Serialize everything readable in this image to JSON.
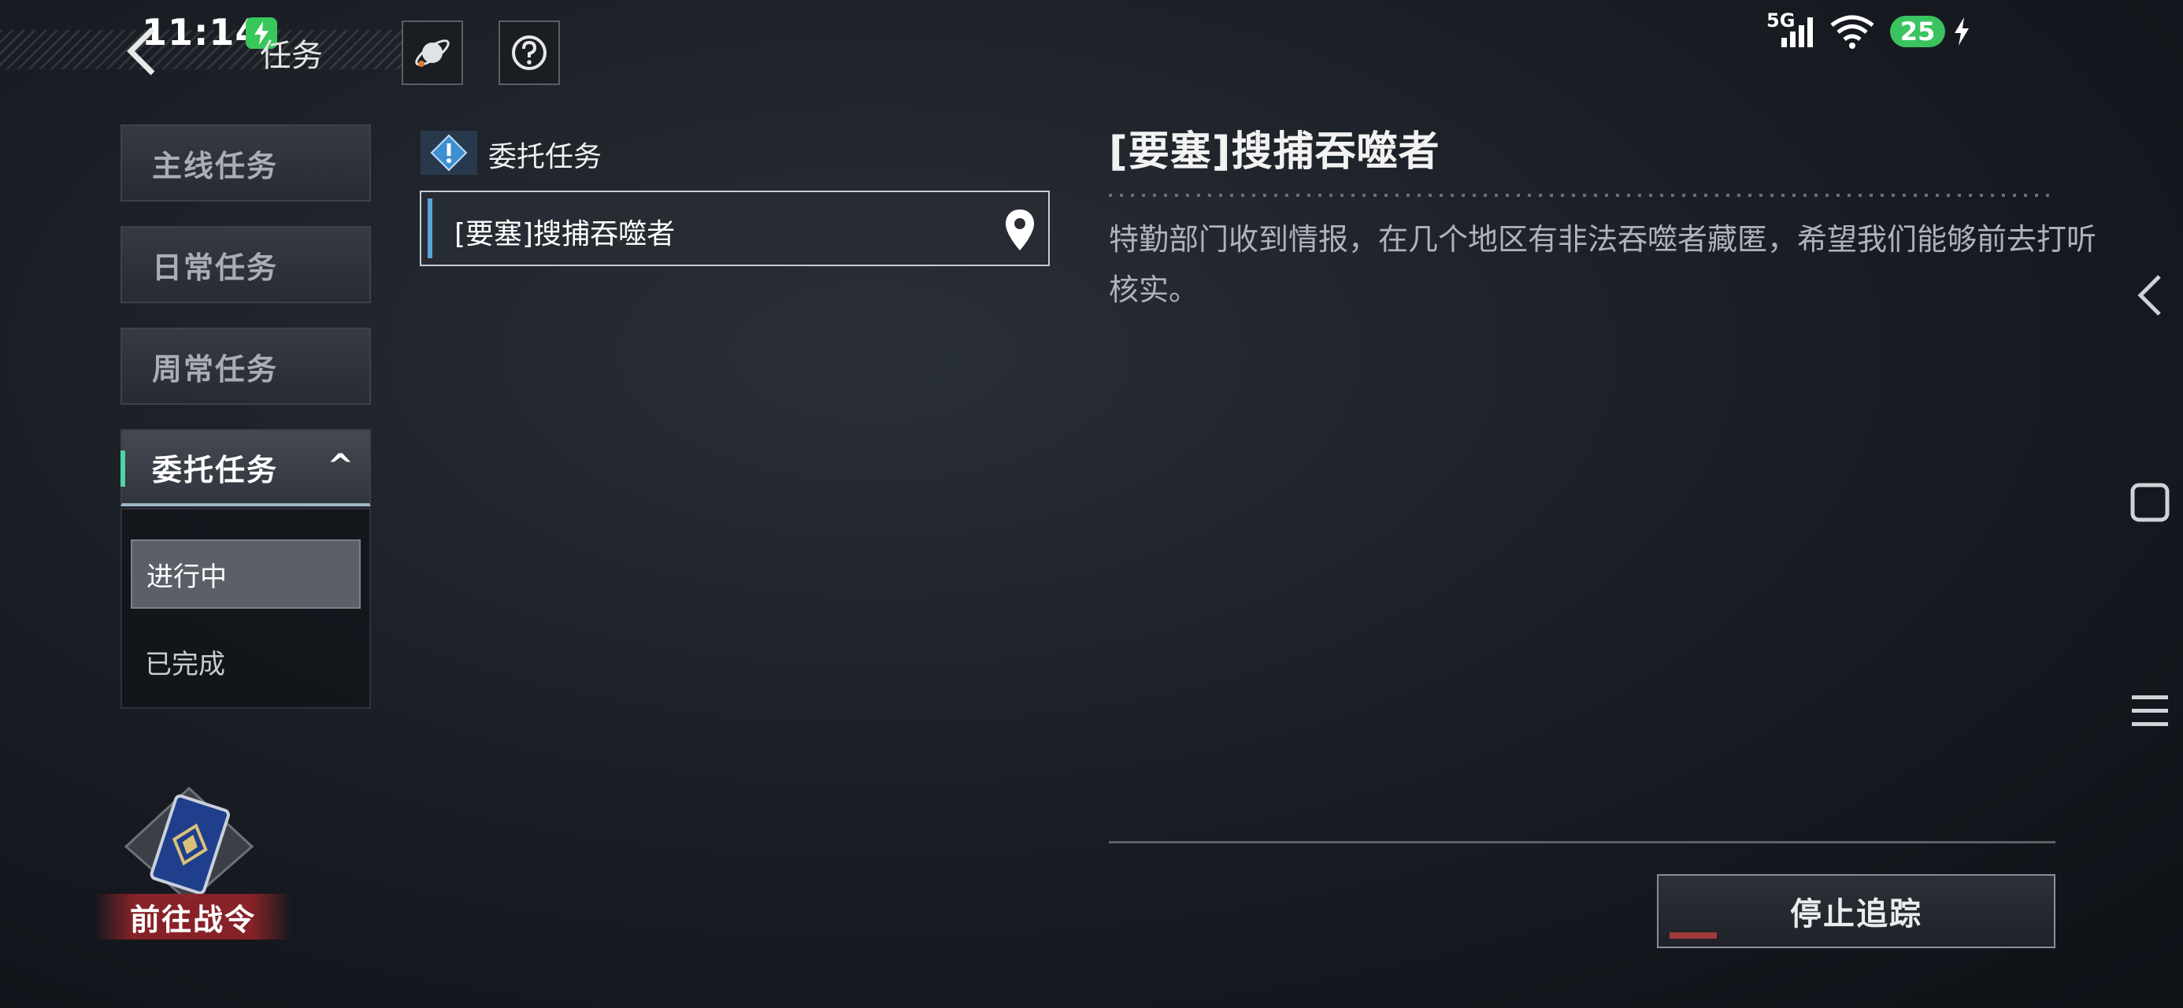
{
  "status_bar": {
    "time": "11:14",
    "network": "5G",
    "battery": "25"
  },
  "header": {
    "title": "任务"
  },
  "sidebar": {
    "items": [
      {
        "label": "主线任务"
      },
      {
        "label": "日常任务"
      },
      {
        "label": "周常任务"
      },
      {
        "label": "委托任务"
      }
    ],
    "sub_items": [
      {
        "label": "进行中"
      },
      {
        "label": "已完成"
      }
    ]
  },
  "battle_pass": {
    "label": "前往战令"
  },
  "quest_list": {
    "category": "委托任务",
    "items": [
      {
        "label": "[要塞]搜捕吞噬者"
      }
    ]
  },
  "detail": {
    "title": "[要塞]搜捕吞噬者",
    "description": "特勤部门收到情报，在几个地区有非法吞噬者藏匿，希望我们能够前去打听核实。",
    "stop_button": "停止追踪"
  },
  "colors": {
    "accent_teal": "#4fd3a8",
    "quest_bar_blue": "#5ba4d8",
    "battle_pass_red": "#8c2328",
    "battery_green": "#3ac35f"
  }
}
